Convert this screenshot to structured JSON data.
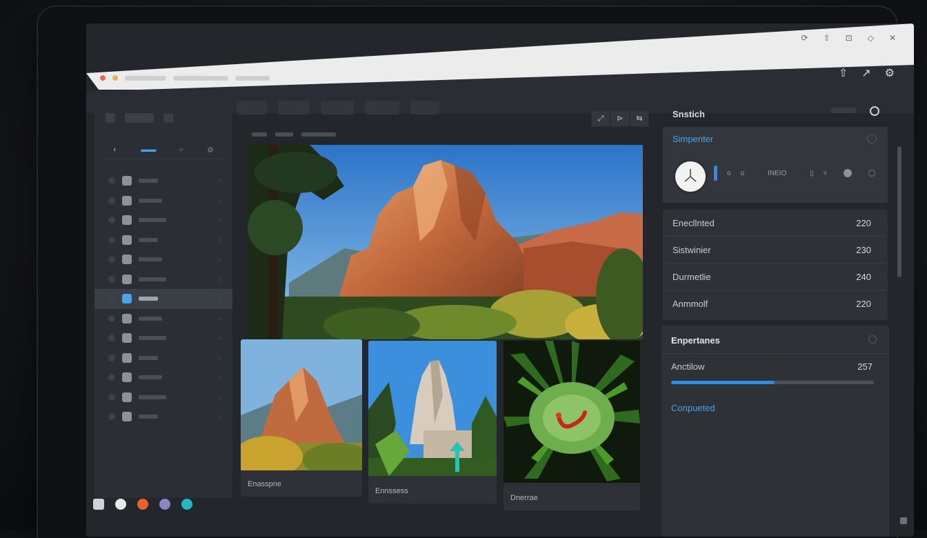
{
  "sidebar": {
    "header_label": "",
    "tab_items": [
      "",
      "",
      ""
    ],
    "active_tab_index": 1,
    "items": [
      {
        "label": "",
        "selected": false
      },
      {
        "label": "",
        "selected": false
      },
      {
        "label": "",
        "selected": false
      },
      {
        "label": "",
        "selected": false
      },
      {
        "label": "",
        "selected": false
      },
      {
        "label": "",
        "selected": false
      },
      {
        "label": "",
        "selected": true
      },
      {
        "label": "",
        "selected": false
      },
      {
        "label": "",
        "selected": false
      },
      {
        "label": "",
        "selected": false
      },
      {
        "label": "",
        "selected": false
      },
      {
        "label": "",
        "selected": false
      },
      {
        "label": "",
        "selected": false
      }
    ]
  },
  "toolbar": {
    "buttons": [
      "",
      "",
      "",
      "",
      ""
    ]
  },
  "view_buttons": [
    "⤢",
    "⊳",
    "⇆"
  ],
  "gallery": {
    "cards": [
      {
        "caption": "Enasspne"
      },
      {
        "caption": "Ennssess"
      },
      {
        "caption": "Dnerrae"
      }
    ]
  },
  "right_panel": {
    "title": "Snstich",
    "count": "",
    "selected_box": {
      "title": "Simperiter",
      "field_label": "INEIO",
      "ctrl_a": "o",
      "ctrl_b": "o"
    },
    "stats": [
      {
        "label": "Enecllnted",
        "value": "220"
      },
      {
        "label": "Sistwinier",
        "value": "230"
      },
      {
        "label": "Durmetlie",
        "value": "240"
      },
      {
        "label": "Anmmolf",
        "value": "220"
      }
    ],
    "section": {
      "title": "Enpertanes",
      "progress_label": "Anctilow",
      "progress_value": "257",
      "progress_fraction": 0.51,
      "status": "Conpueted"
    }
  },
  "colors": {
    "accent": "#2d8ce8",
    "panel": "#2e3136",
    "background": "#23262b"
  }
}
